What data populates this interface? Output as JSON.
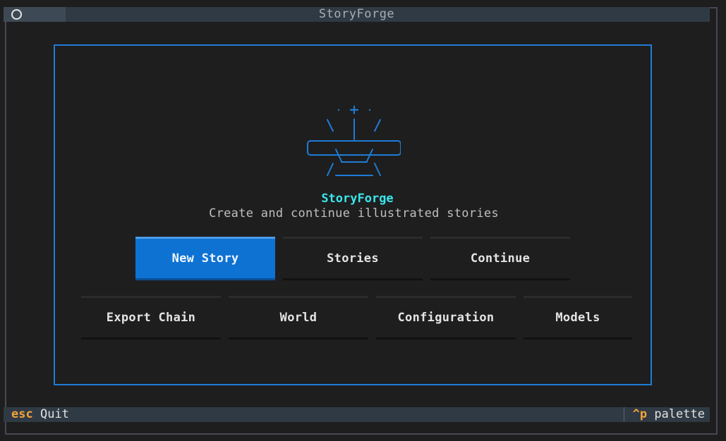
{
  "window": {
    "title": "StoryForge"
  },
  "hero": {
    "app_name": "StoryForge",
    "subtitle": "Create and continue illustrated stories"
  },
  "buttons": {
    "row1": [
      {
        "label": "New Story",
        "primary": true
      },
      {
        "label": "Stories"
      },
      {
        "label": "Continue"
      }
    ],
    "row2": [
      {
        "label": "Export Chain"
      },
      {
        "label": "World"
      },
      {
        "label": "Configuration"
      },
      {
        "label": "Models"
      }
    ]
  },
  "footer": {
    "quit_key": "esc",
    "quit_label": "Quit",
    "palette_key": "^p",
    "palette_label": "palette"
  },
  "colors": {
    "accent": "#1f7bd6",
    "primary_button": "#0e72d3",
    "title_cyan": "#39e6ec",
    "key_orange": "#f2a33a"
  },
  "icons": {
    "title_circle": "circle-icon",
    "logo": "storyforge-logo-icon"
  }
}
